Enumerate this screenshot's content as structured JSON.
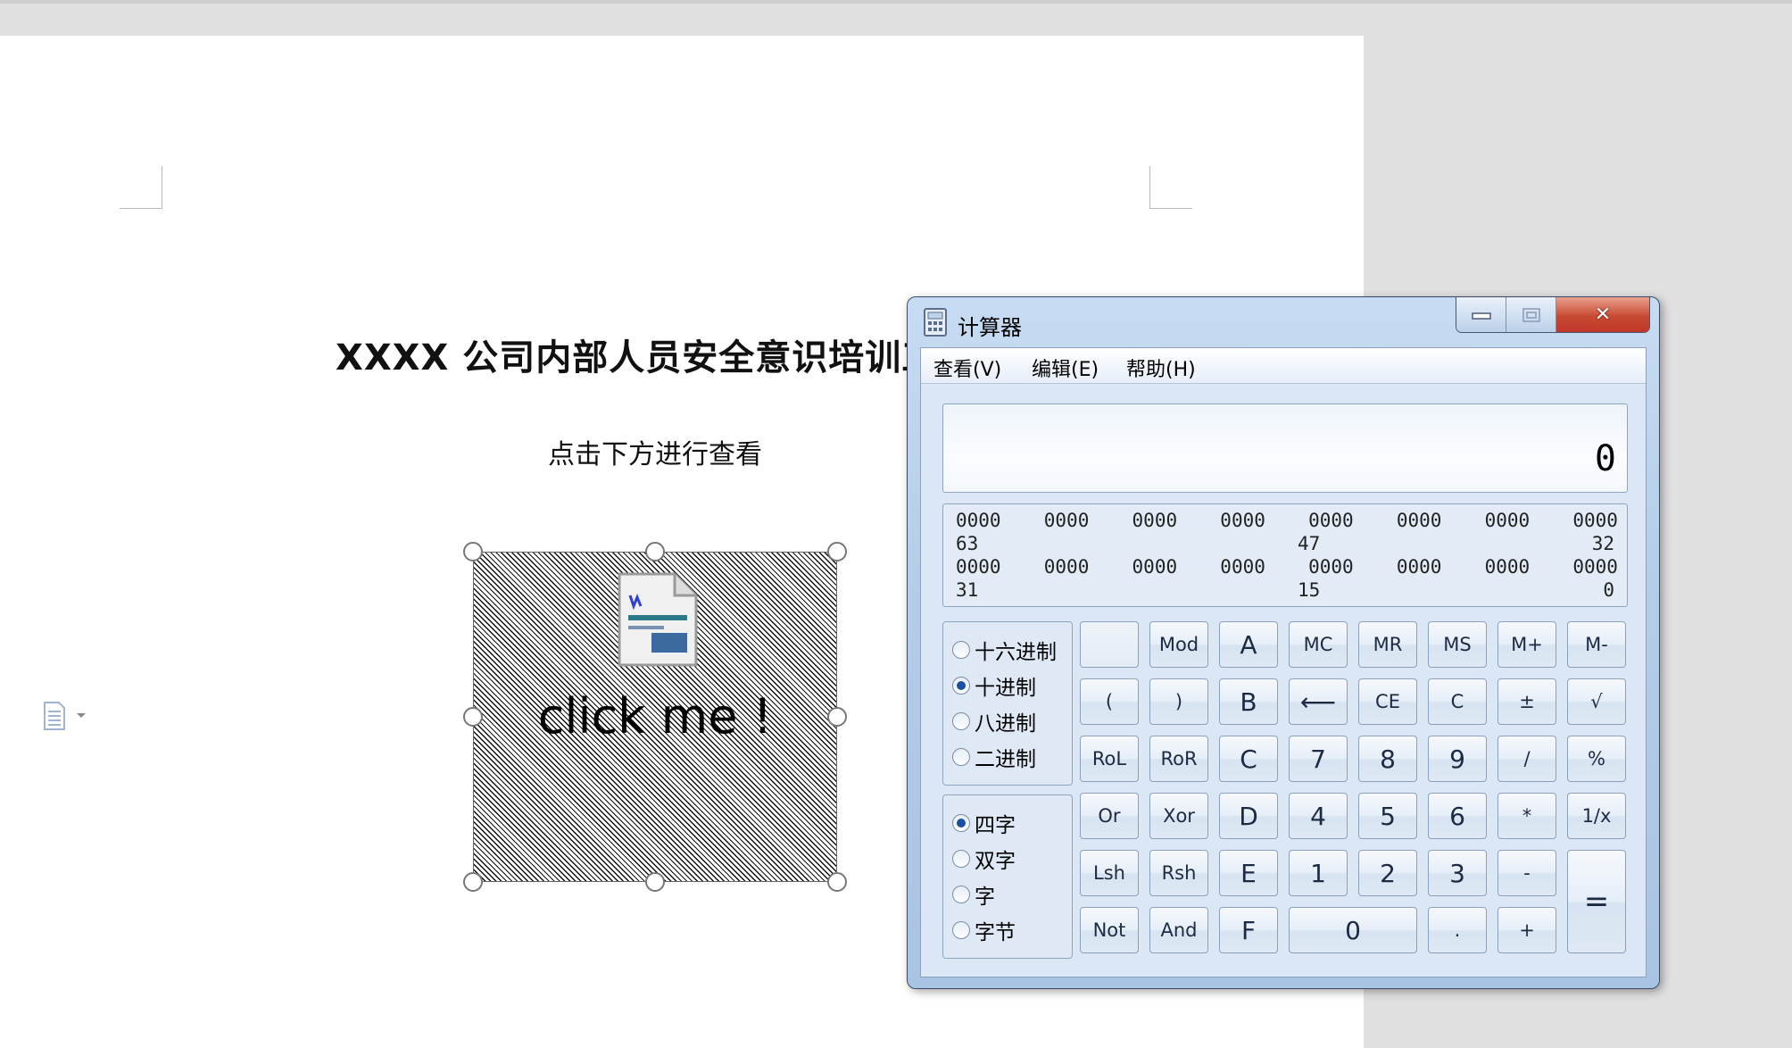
{
  "document": {
    "title": "XXXX 公司内部人员安全意识培训工",
    "subtitle": "点击下方进行查看",
    "ole_label": "click me !",
    "side_icon": "document-layout-icon"
  },
  "calculator": {
    "title": "计算器",
    "app_icon": "calculator-icon",
    "caption": {
      "minimize": "▭",
      "maximize": "▢",
      "close": "✕"
    },
    "menu": [
      "查看(V)",
      "编辑(E)",
      "帮助(H)"
    ],
    "display_value": "0",
    "bits": {
      "row1": [
        "0000",
        "0000",
        "0000",
        "0000",
        "0000",
        "0000",
        "0000",
        "0000"
      ],
      "row1_index": [
        "63",
        "47",
        "32"
      ],
      "row2": [
        "0000",
        "0000",
        "0000",
        "0000",
        "0000",
        "0000",
        "0000",
        "0000"
      ],
      "row2_index": [
        "31",
        "15",
        "0"
      ]
    },
    "base_options": [
      "十六进制",
      "十进制",
      "八进制",
      "二进制"
    ],
    "base_selected": "十进制",
    "word_options": [
      "四字",
      "双字",
      "字",
      "字节"
    ],
    "word_selected": "四字",
    "keys": {
      "blank": "",
      "mod": "Mod",
      "a": "A",
      "mc": "MC",
      "mr": "MR",
      "ms": "MS",
      "mplus": "M+",
      "mminus": "M-",
      "lparen": "(",
      "rparen": ")",
      "b": "B",
      "back": "⟵",
      "ce": "CE",
      "c": "C",
      "plusminus": "±",
      "sqrt": "√",
      "rol": "RoL",
      "ror": "RoR",
      "hex_c": "C",
      "d7": "7",
      "d8": "8",
      "d9": "9",
      "div": "/",
      "pct": "%",
      "or": "Or",
      "xor": "Xor",
      "d": "D",
      "d4": "4",
      "d5": "5",
      "d6": "6",
      "mul": "*",
      "recip": "1/x",
      "lsh": "Lsh",
      "rsh": "Rsh",
      "e": "E",
      "d1": "1",
      "d2": "2",
      "d3": "3",
      "sub": "-",
      "eq": "=",
      "not": "Not",
      "and": "And",
      "f": "F",
      "d0": "0",
      "dot": ".",
      "add": "+"
    }
  }
}
